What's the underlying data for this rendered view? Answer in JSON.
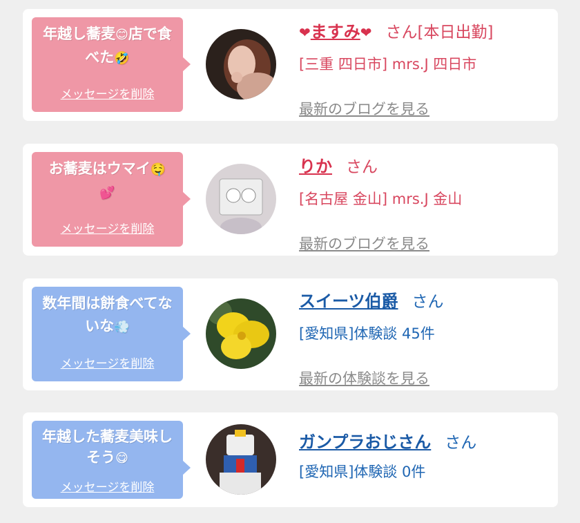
{
  "cards": [
    {
      "message": "年越し蕎麦",
      "message_emoji1": "😊",
      "message_mid": "店で食べた",
      "message_emoji2": "🤣",
      "delete_label": "メッセージを削除",
      "heart_left": "❤",
      "name": "ますみ",
      "heart_right": "❤",
      "san": "さん",
      "status": "[本日出勤]",
      "sub": "[三重 四日市] mrs.J 四日市",
      "more": "最新のブログを見る"
    },
    {
      "message": "お蕎麦はウマイ",
      "message_emoji1": "🤤",
      "message_emoji2": "💕",
      "delete_label": "メッセージを削除",
      "name": "りか",
      "san": "さん",
      "sub": "[名古屋 金山] mrs.J 金山",
      "more": "最新のブログを見る"
    },
    {
      "message": "数年間は餅食べてないな",
      "message_emoji1": "💨",
      "delete_label": "メッセージを削除",
      "name": "スイーツ伯爵",
      "san": "さん",
      "sub": "[愛知県]体験談 45件",
      "more": "最新の体験談を見る"
    },
    {
      "message": "年越した蕎麦美味しそう",
      "message_emoji1": "😋",
      "delete_label": "メッセージを削除",
      "name": "ガンプラおじさん",
      "san": "さん",
      "sub": "[愛知県]体験談 0件"
    }
  ],
  "colors": {
    "pink_bubble": "#ef97a6",
    "blue_bubble": "#94b6ef",
    "red_text": "#d8324e",
    "blue_text": "#1a5aa6",
    "link_gray": "#8a8a8a"
  }
}
